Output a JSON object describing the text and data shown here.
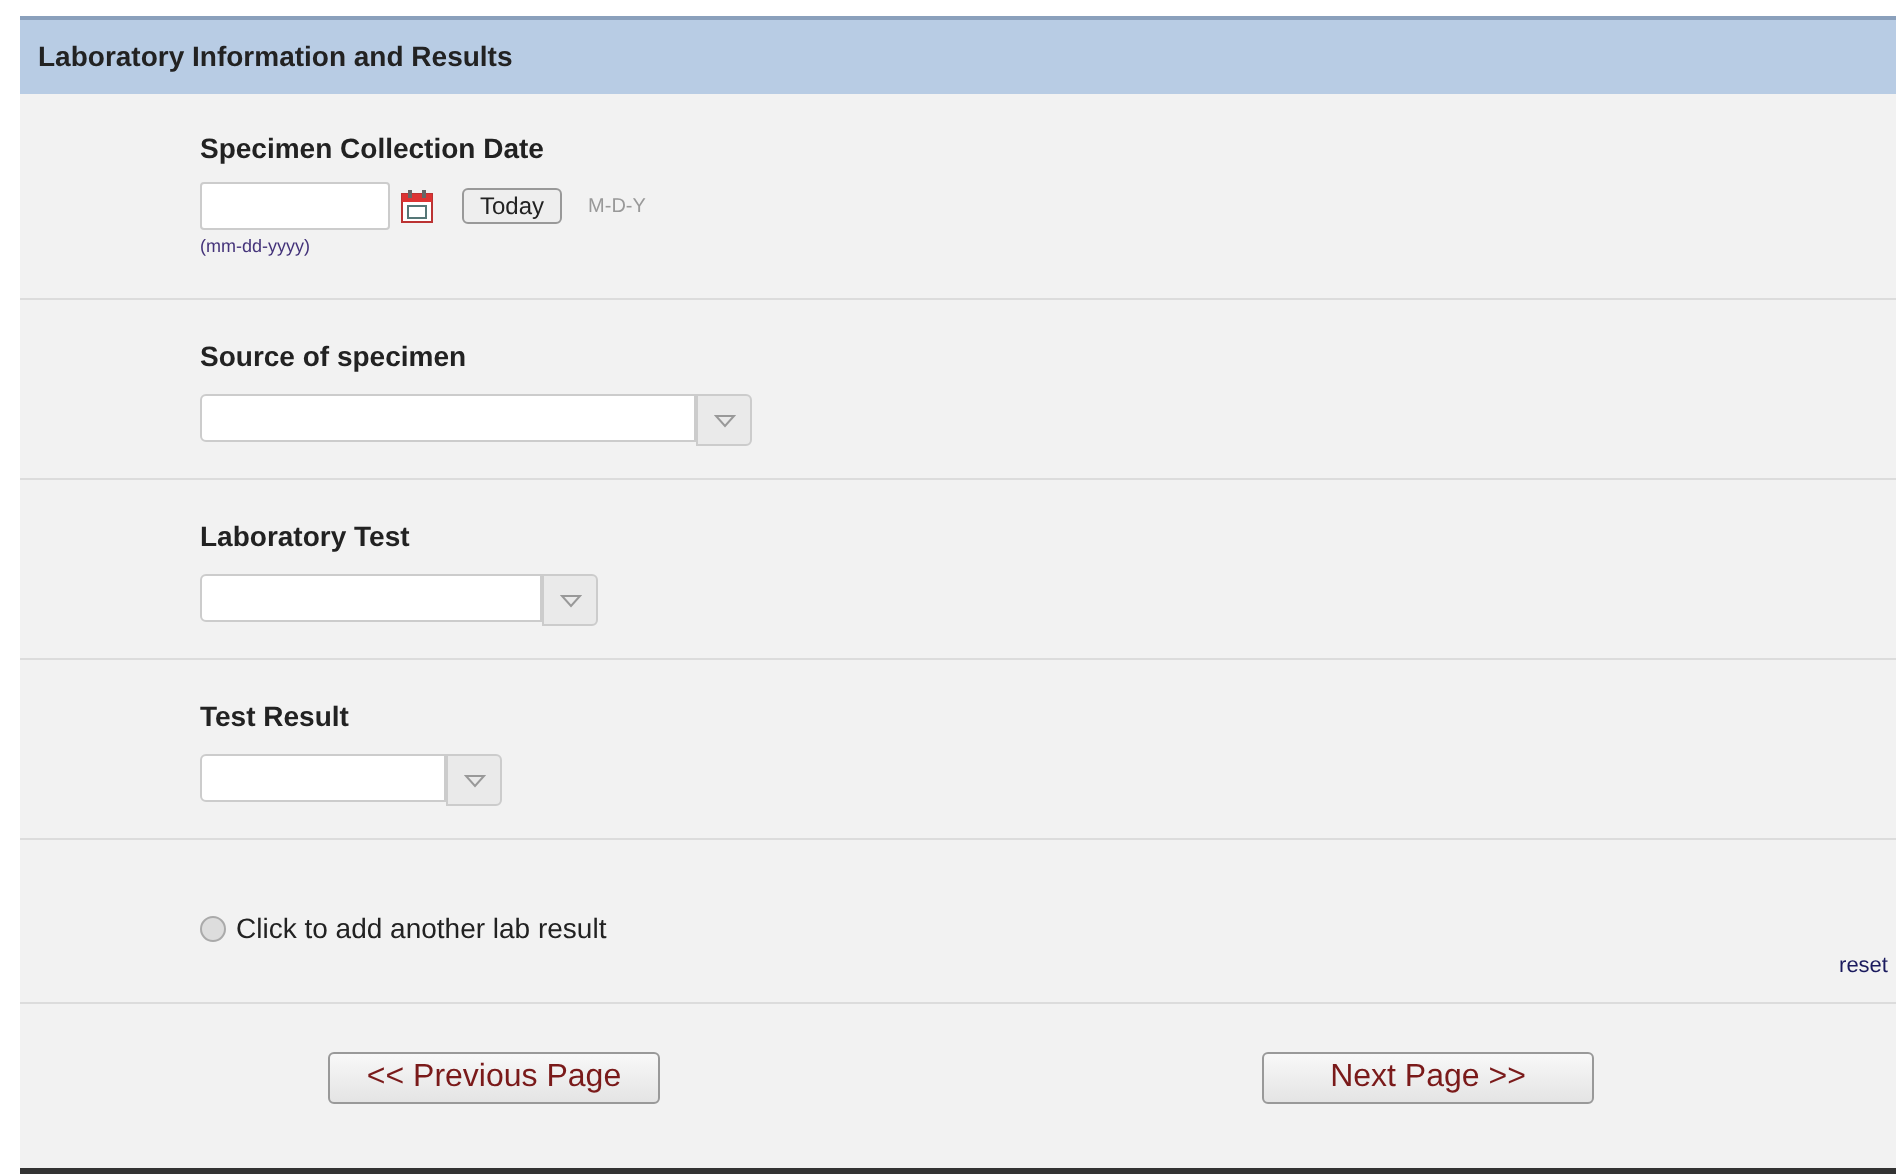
{
  "section": {
    "title": "Laboratory Information and Results"
  },
  "date_field": {
    "label": "Specimen Collection Date",
    "today_button": "Today",
    "format": "M-D-Y",
    "hint": "(mm-dd-yyyy)"
  },
  "selects": [
    {
      "label": "Source of specimen",
      "kind": "wide"
    },
    {
      "label": "Laboratory Test",
      "kind": "medium"
    },
    {
      "label": "Test Result",
      "kind": "narrow"
    }
  ],
  "add_result": {
    "label": "Click to add another lab result",
    "checked": false
  },
  "reset_link": "reset",
  "buttons": [
    "<< Previous Page",
    "Next Page >>"
  ]
}
